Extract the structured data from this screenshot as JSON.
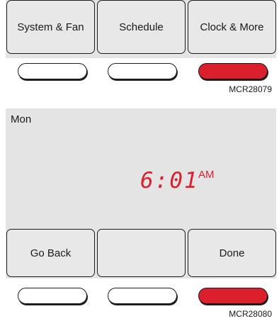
{
  "panel_1": {
    "soft_keys": [
      "System & Fan",
      "Schedule",
      "Clock & More"
    ],
    "hardware_buttons": [
      {
        "color": "#ffffff",
        "pressed": false
      },
      {
        "color": "#ffffff",
        "pressed": false
      },
      {
        "color": "#dc1f2d",
        "pressed": true
      }
    ],
    "figure_code": "MCR28079"
  },
  "panel_2": {
    "day": "Mon",
    "time": "6:01",
    "ampm": "AM",
    "soft_keys": [
      "Go Back",
      "",
      "Done"
    ],
    "hardware_buttons": [
      {
        "color": "#ffffff",
        "pressed": false
      },
      {
        "color": "#ffffff",
        "pressed": false
      },
      {
        "color": "#dc1f2d",
        "pressed": true
      }
    ],
    "figure_code": "MCR28080"
  },
  "colors": {
    "screen_background": "#e4e4e4",
    "display_red": "#dc1f2d",
    "outline": "#1d1d1d"
  }
}
